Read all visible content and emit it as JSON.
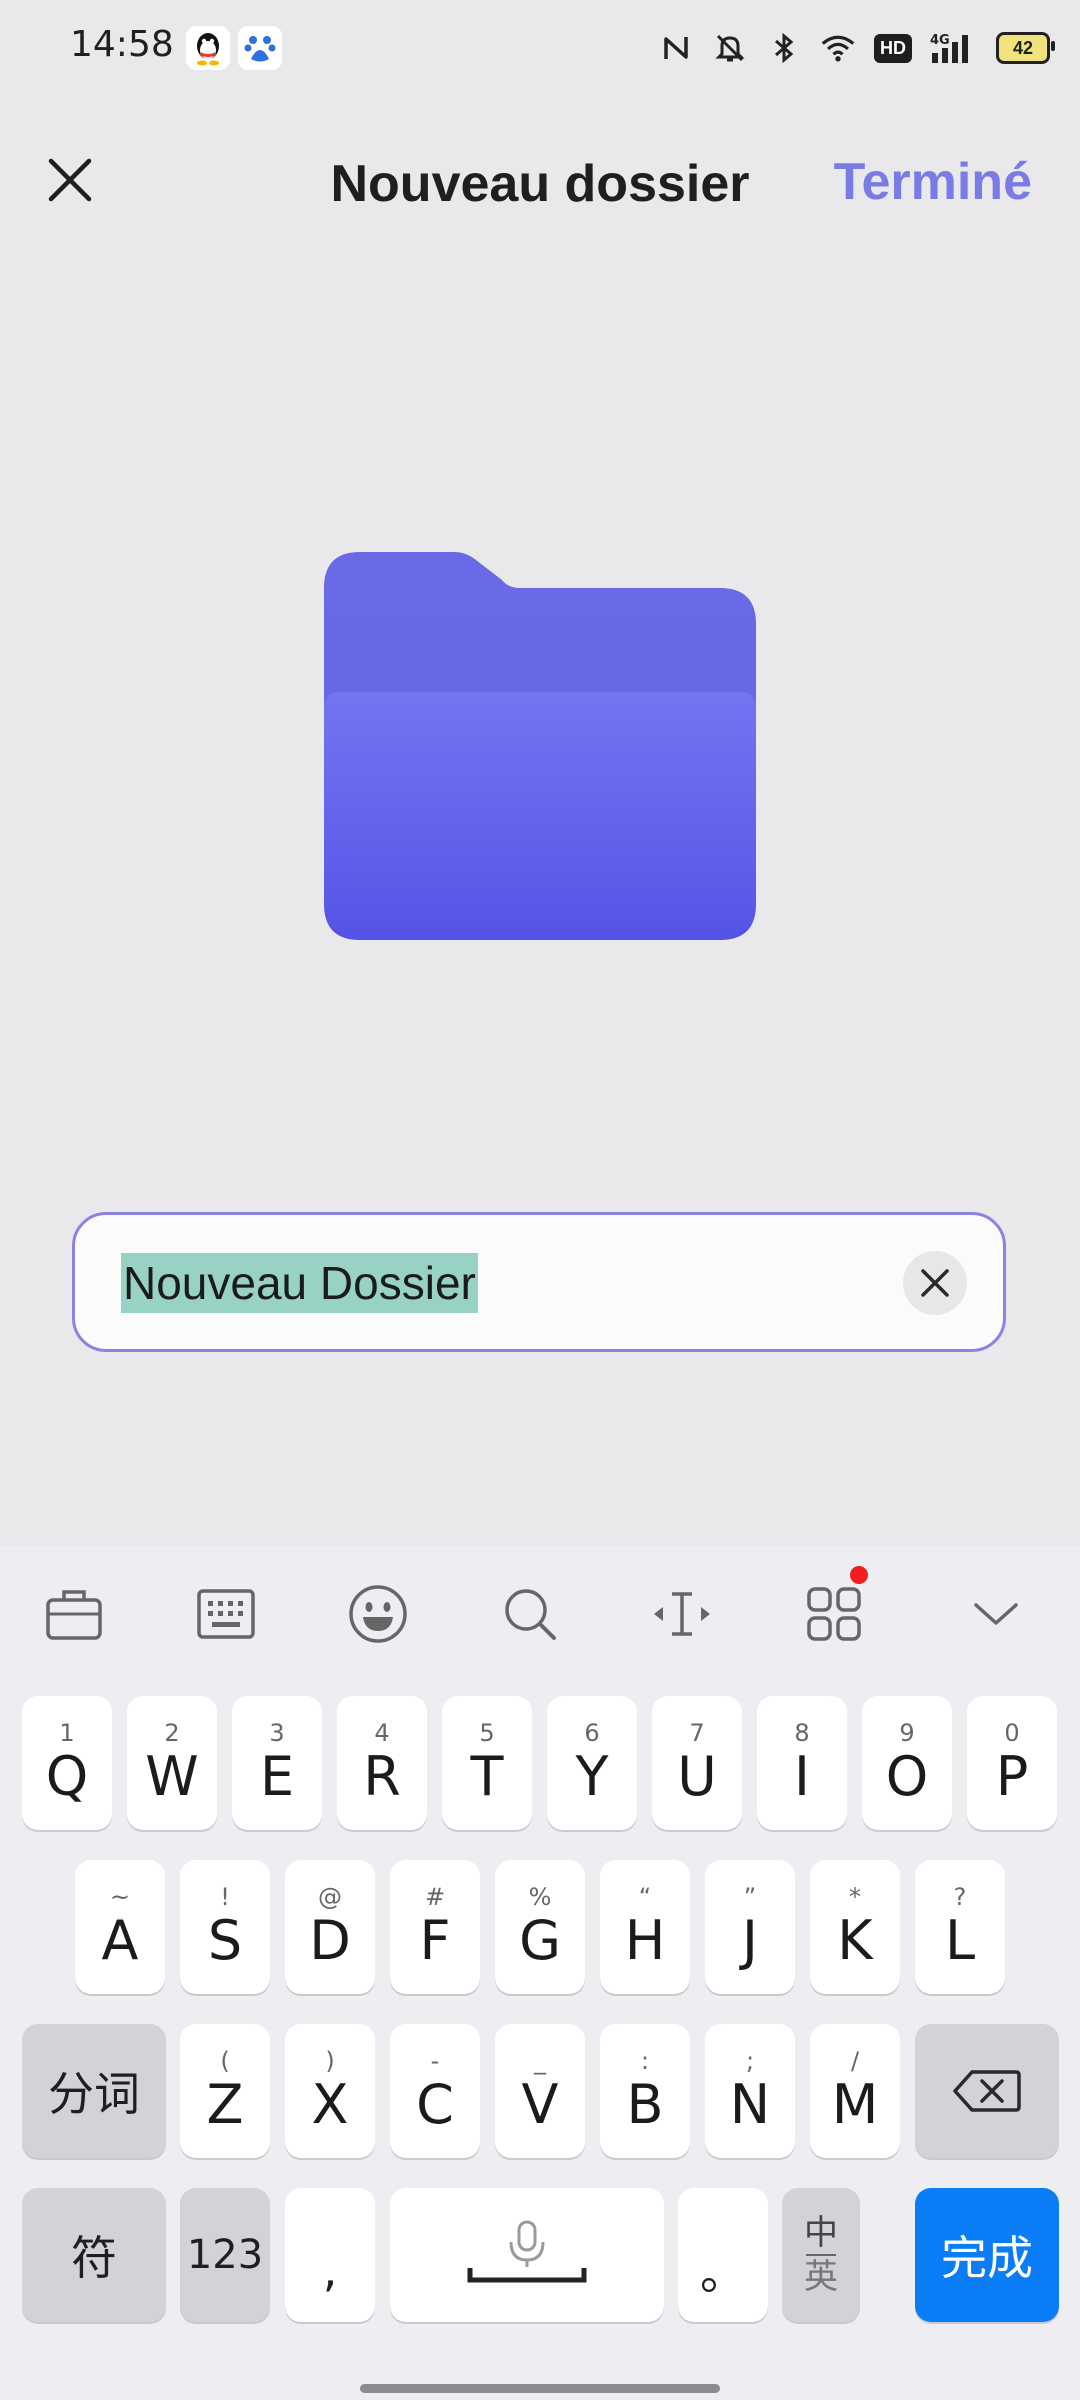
{
  "status_bar": {
    "time": "14:58",
    "hd_label": "HD",
    "network_label": "4G",
    "battery": "42",
    "icons": [
      "qq-icon",
      "baidu-icon",
      "nfc-icon",
      "mute-icon",
      "bluetooth-icon",
      "wifi-icon",
      "hd-icon",
      "signal-icon",
      "battery-icon"
    ]
  },
  "header": {
    "title": "Nouveau dossier",
    "done_label": "Terminé"
  },
  "folder": {
    "icon": "folder-icon",
    "color": "#5d5ce8"
  },
  "name_input": {
    "value": "Nouveau Dossier",
    "selection_color": "#98d2c4",
    "border_color": "#8a84e0"
  },
  "keyboard": {
    "toolbar_icons": [
      "toolbox-icon",
      "keyboard-icon",
      "emoji-icon",
      "search-icon",
      "cursor-icon",
      "apps-icon",
      "collapse-icon"
    ],
    "row1": [
      {
        "sub": "1",
        "main": "Q"
      },
      {
        "sub": "2",
        "main": "W"
      },
      {
        "sub": "3",
        "main": "E"
      },
      {
        "sub": "4",
        "main": "R"
      },
      {
        "sub": "5",
        "main": "T"
      },
      {
        "sub": "6",
        "main": "Y"
      },
      {
        "sub": "7",
        "main": "U"
      },
      {
        "sub": "8",
        "main": "I"
      },
      {
        "sub": "9",
        "main": "O"
      },
      {
        "sub": "0",
        "main": "P"
      }
    ],
    "row2": [
      {
        "sub": "~",
        "main": "A"
      },
      {
        "sub": "!",
        "main": "S"
      },
      {
        "sub": "@",
        "main": "D"
      },
      {
        "sub": "#",
        "main": "F"
      },
      {
        "sub": "%",
        "main": "G"
      },
      {
        "sub": "“",
        "main": "H"
      },
      {
        "sub": "”",
        "main": "J"
      },
      {
        "sub": "*",
        "main": "K"
      },
      {
        "sub": "?",
        "main": "L"
      }
    ],
    "row3": [
      {
        "sub": "(",
        "main": "Z"
      },
      {
        "sub": ")",
        "main": "X"
      },
      {
        "sub": "-",
        "main": "C"
      },
      {
        "sub": "_",
        "main": "V"
      },
      {
        "sub": ":",
        "main": "B"
      },
      {
        "sub": ";",
        "main": "N"
      },
      {
        "sub": "/",
        "main": "M"
      }
    ],
    "segment_label": "分词",
    "symbols_label": "符",
    "numbers_label": "123",
    "comma_label": ",",
    "period_label": "。",
    "lang_top": "中",
    "lang_bottom": "英",
    "done_label": "完成",
    "accent_color": "#0a7cf5"
  }
}
